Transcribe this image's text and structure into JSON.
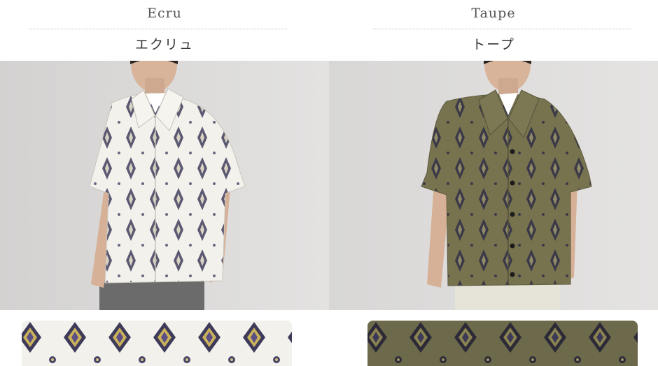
{
  "colors": [
    {
      "name_en": "Ecru",
      "name_jp": "エクリュ",
      "shirt_color": "#f3f1ec",
      "motif_color": "#3f3b58",
      "swatch_bg": "#f2f1ec"
    },
    {
      "name_en": "Taupe",
      "name_jp": "トープ",
      "shirt_color": "#77734f",
      "motif_color": "#2e2b3a",
      "swatch_bg": "#6d6a4c"
    }
  ]
}
